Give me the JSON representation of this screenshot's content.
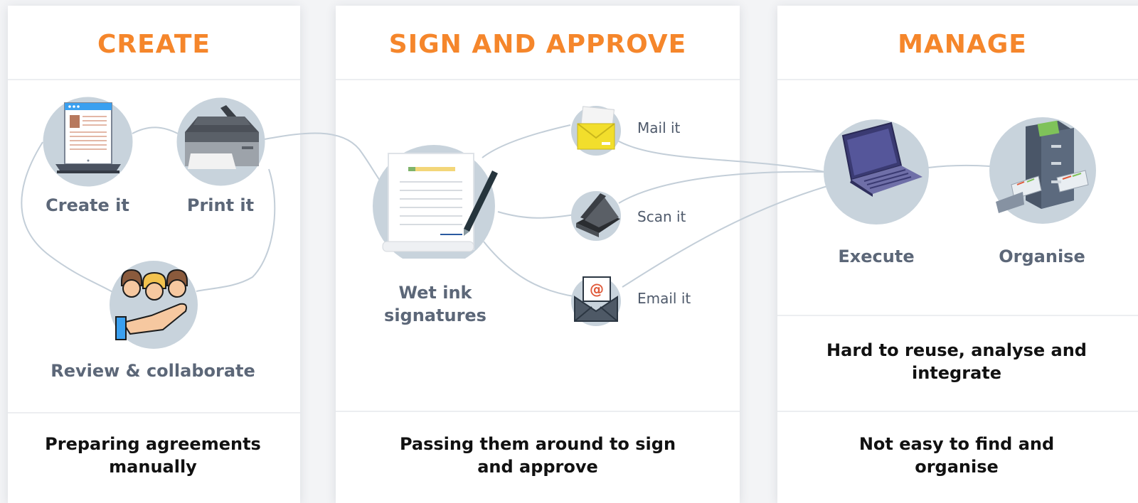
{
  "create": {
    "title": "CREATE",
    "steps": {
      "create_it": "Create it",
      "print_it": "Print it",
      "review": "Review & collaborate"
    },
    "description": "Preparing agreements manually"
  },
  "sign": {
    "title": "SIGN AND APPROVE",
    "main_label": "Wet ink signatures",
    "options": {
      "mail": "Mail it",
      "scan": "Scan it",
      "email": "Email it"
    },
    "description": "Passing them around to sign and approve"
  },
  "manage": {
    "title": "MANAGE",
    "steps": {
      "execute": "Execute",
      "organise": "Organise"
    },
    "description_1": "Hard to reuse, analyse and integrate",
    "description_2": "Not easy to find and organise"
  },
  "colors": {
    "accent": "#f5862b",
    "icon_circle": "#c8d3dc",
    "connector": "#c3ced8",
    "label_text": "#5c6778"
  },
  "icons": [
    "laptop-document-icon",
    "printer-icon",
    "team-hand-icon",
    "signed-document-icon",
    "mail-envelope-icon",
    "scanner-icon",
    "email-envelope-icon",
    "laptop-icon",
    "filing-cabinet-icon"
  ]
}
